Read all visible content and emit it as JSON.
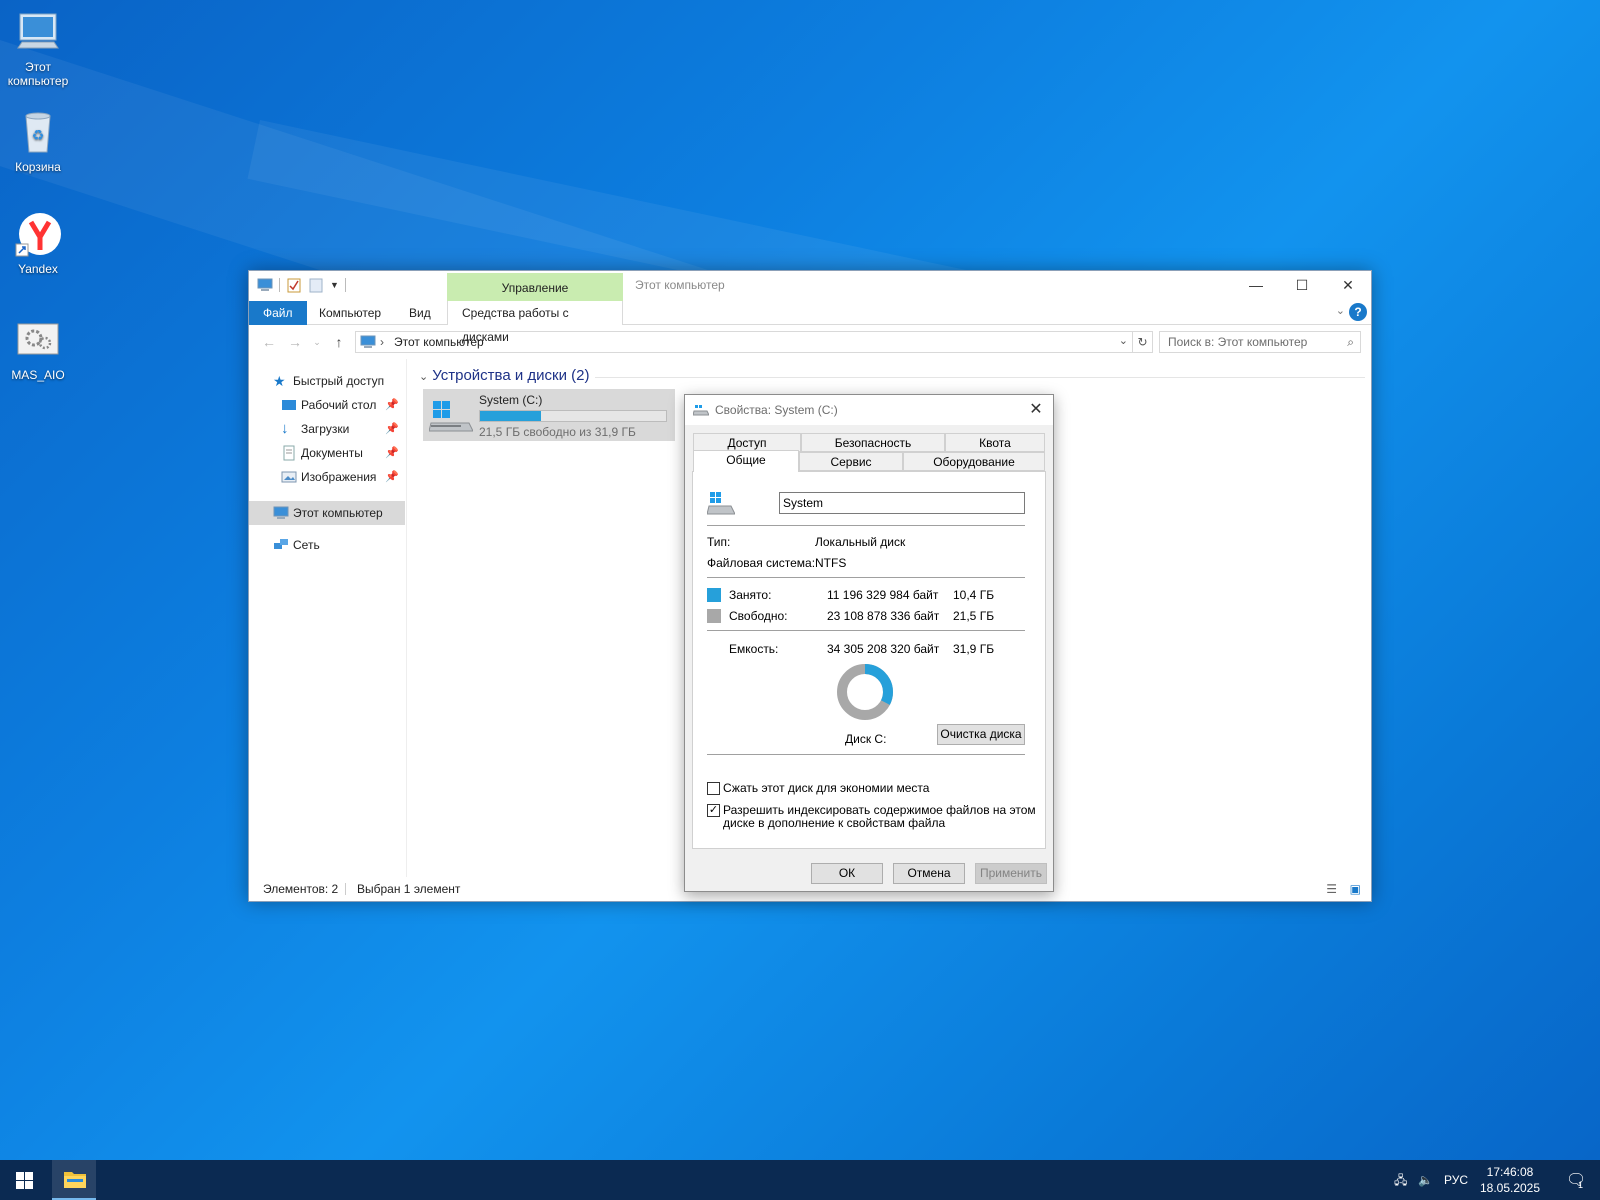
{
  "desktop": {
    "icons": [
      {
        "label": "Этот компьютер"
      },
      {
        "label": "Корзина"
      },
      {
        "label": "Yandex"
      },
      {
        "label": "MAS_AIO"
      }
    ]
  },
  "explorer": {
    "title": "Этот компьютер",
    "contextual_tab": "Управление",
    "ribbon_tabs": {
      "file": "Файл",
      "computer": "Компьютер",
      "view": "Вид",
      "disk_tools": "Средства работы с дисками"
    },
    "address": "Этот компьютер",
    "search_placeholder": "Поиск в: Этот компьютер",
    "nav": {
      "quick_access": "Быстрый доступ",
      "desktop": "Рабочий стол",
      "downloads": "Загрузки",
      "documents": "Документы",
      "images": "Изображения",
      "this_pc": "Этот компьютер",
      "network": "Сеть"
    },
    "group_header": "Устройства и диски (2)",
    "drive": {
      "name": "System (C:)",
      "free_text": "21,5 ГБ свободно из 31,9 ГБ",
      "used_fraction": 0.326
    },
    "status": {
      "items": "Элементов: 2",
      "selected": "Выбран 1 элемент"
    }
  },
  "dialog": {
    "title": "Свойства: System (C:)",
    "tabs": {
      "access": "Доступ",
      "security": "Безопасность",
      "quota": "Квота",
      "general": "Общие",
      "service": "Сервис",
      "hardware": "Оборудование"
    },
    "name_value": "System",
    "type_label": "Тип:",
    "type_value": "Локальный диск",
    "fs_label": "Файловая система:",
    "fs_value": "NTFS",
    "used_label": "Занято:",
    "used_bytes": "11 196 329 984 байт",
    "used_gb": "10,4 ГБ",
    "free_label": "Свободно:",
    "free_bytes": "23 108 878 336 байт",
    "free_gb": "21,5 ГБ",
    "capacity_label": "Емкость:",
    "capacity_bytes": "34 305 208 320 байт",
    "capacity_gb": "31,9 ГБ",
    "used_fraction": 0.326,
    "used_color": "#26a0da",
    "free_color": "#a8a8a8",
    "disk_label": "Диск C:",
    "cleanup_button": "Очистка диска",
    "compress_label": "Сжать этот диск для экономии места",
    "compress_checked": false,
    "index_label_line1": "Разрешить индексировать содержимое файлов на этом",
    "index_label_line2": "диске в дополнение к свойствам файла",
    "index_checked": true,
    "ok": "ОК",
    "cancel": "Отмена",
    "apply": "Применить"
  },
  "taskbar": {
    "language": "РУС",
    "time": "17:46:08",
    "date": "18.05.2025",
    "notifications_count": "1"
  }
}
